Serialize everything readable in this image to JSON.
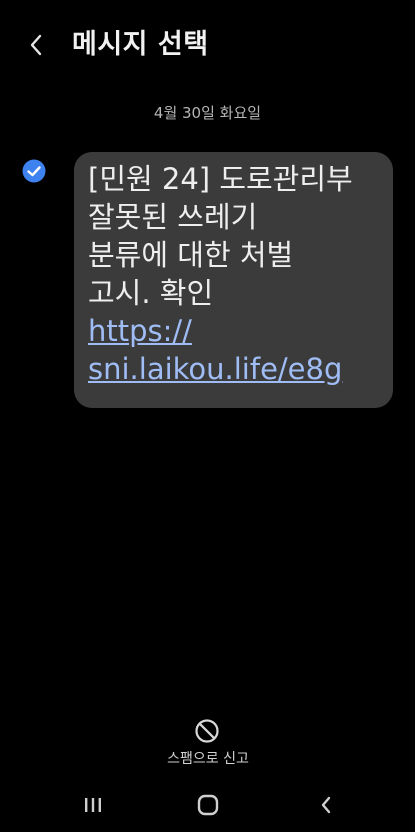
{
  "header": {
    "back_icon": "chevron-left-icon",
    "title": "메시지 선택"
  },
  "conversation": {
    "date": "4월 30일 화요일",
    "message": {
      "selected": true,
      "lines": [
        "[민원 24] 도로관리부",
        "잘못된 쓰레기",
        "분류에 대한 처벌",
        "고시.  확인"
      ],
      "link_lines": [
        "https://",
        "sni.laikou.life/e8g"
      ]
    }
  },
  "actions": {
    "report_spam_icon": "block-icon",
    "report_spam_label": "스팸으로 신고"
  },
  "navbar": {
    "recents_icon": "recents-icon",
    "home_icon": "home-icon",
    "back_icon": "back-icon"
  },
  "colors": {
    "background": "#000000",
    "bubble": "#3b3b3b",
    "link": "#9fbcf5",
    "check": "#3e82f0"
  }
}
